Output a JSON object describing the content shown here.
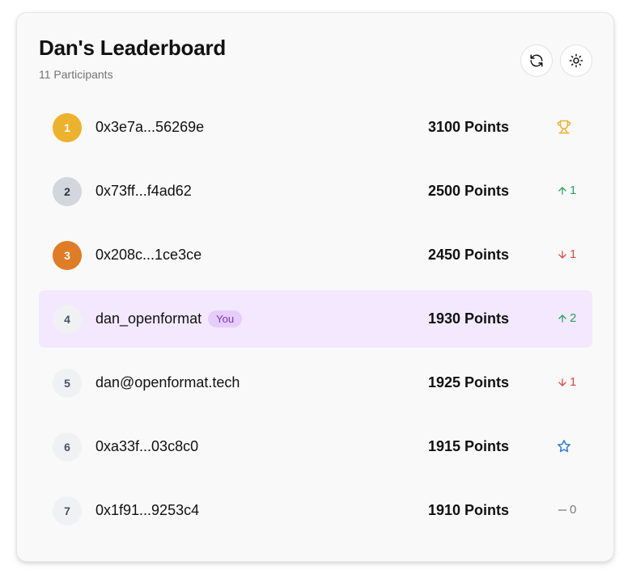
{
  "header": {
    "title": "Dan's Leaderboard",
    "subtitle": "11 Participants"
  },
  "toolbar": {
    "refresh_icon": "refresh-icon",
    "theme_icon": "sun-icon"
  },
  "colors": {
    "gold": "#ecb22e",
    "silver": "#d3d6dc",
    "bronze": "#e07b26",
    "highlight": "#f3e8fd",
    "up": "#22a35a",
    "down": "#e04444",
    "star": "#2f7ae5"
  },
  "rows": [
    {
      "rank": "1",
      "name": "0x3e7a...56269e",
      "points": "3100 Points",
      "change": "",
      "change_type": "trophy",
      "badge": ""
    },
    {
      "rank": "2",
      "name": "0x73ff...f4ad62",
      "points": "2500 Points",
      "change": "1",
      "change_type": "up",
      "badge": ""
    },
    {
      "rank": "3",
      "name": "0x208c...1ce3ce",
      "points": "2450 Points",
      "change": "1",
      "change_type": "down",
      "badge": ""
    },
    {
      "rank": "4",
      "name": "dan_openformat",
      "points": "1930 Points",
      "change": "2",
      "change_type": "up",
      "badge": "You"
    },
    {
      "rank": "5",
      "name": "dan@openformat.tech",
      "points": "1925 Points",
      "change": "1",
      "change_type": "down",
      "badge": ""
    },
    {
      "rank": "6",
      "name": "0xa33f...03c8c0",
      "points": "1915 Points",
      "change": "",
      "change_type": "star",
      "badge": ""
    },
    {
      "rank": "7",
      "name": "0x1f91...9253c4",
      "points": "1910 Points",
      "change": "0",
      "change_type": "neutral",
      "badge": ""
    }
  ]
}
